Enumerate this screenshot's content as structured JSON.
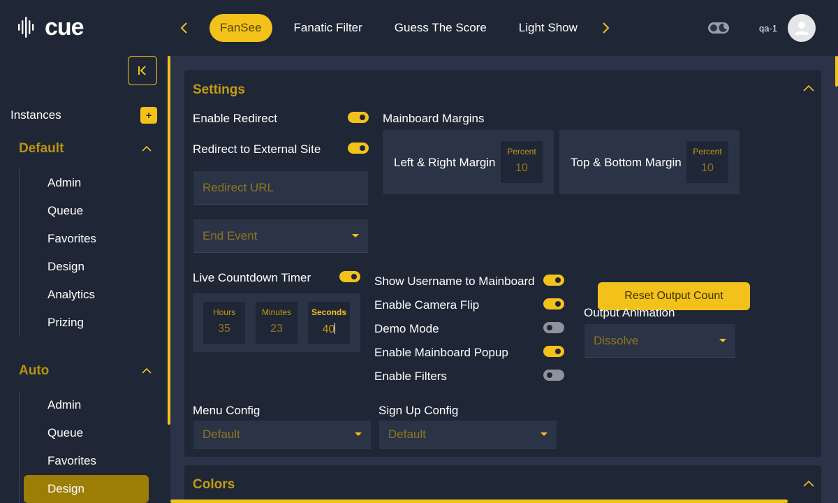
{
  "app": {
    "logo_text": "cue"
  },
  "tabs": [
    {
      "label": "FanSee",
      "active": true
    },
    {
      "label": "Fanatic Filter",
      "active": false
    },
    {
      "label": "Guess The Score",
      "active": false
    },
    {
      "label": "Light Show",
      "active": false
    }
  ],
  "user": {
    "name": "qa-1"
  },
  "sidebar": {
    "instances_label": "Instances",
    "add_label": "+",
    "groups": [
      {
        "title": "Default",
        "items": [
          "Admin",
          "Queue",
          "Favorites",
          "Design",
          "Analytics",
          "Prizing"
        ]
      },
      {
        "title": "Auto",
        "items": [
          "Admin",
          "Queue",
          "Favorites",
          "Design"
        ],
        "active_item": "Design"
      }
    ]
  },
  "settings": {
    "title": "Settings",
    "enable_redirect": {
      "label": "Enable Redirect",
      "on": true
    },
    "redirect_external": {
      "label": "Redirect to External Site",
      "on": true
    },
    "redirect_url_placeholder": "Redirect URL",
    "end_event_placeholder": "End Event",
    "mainboard_margins": {
      "label": "Mainboard Margins",
      "left_right": {
        "label": "Left & Right Margin",
        "unit": "Percent",
        "value": "10"
      },
      "top_bottom": {
        "label": "Top & Bottom Margin",
        "unit": "Percent",
        "value": "10"
      }
    },
    "countdown": {
      "label": "Live Countdown Timer",
      "on": true,
      "hours": {
        "label": "Hours",
        "value": "35"
      },
      "minutes": {
        "label": "Minutes",
        "value": "23"
      },
      "seconds": {
        "label": "Seconds",
        "value": "40"
      }
    },
    "switches": [
      {
        "label": "Show Username to Mainboard",
        "on": true
      },
      {
        "label": "Enable Camera Flip",
        "on": true
      },
      {
        "label": "Demo Mode",
        "on": false
      },
      {
        "label": "Enable Mainboard Popup",
        "on": true
      },
      {
        "label": "Enable Filters",
        "on": false
      }
    ],
    "reset_output_label": "Reset Output Count",
    "output_animation": {
      "label": "Output Animation",
      "value": "Dissolve"
    },
    "menu_config": {
      "label": "Menu Config",
      "value": "Default"
    },
    "signup_config": {
      "label": "Sign Up Config",
      "value": "Default"
    }
  },
  "colors_section": {
    "title": "Colors"
  },
  "accent_color": "#f2c21b"
}
